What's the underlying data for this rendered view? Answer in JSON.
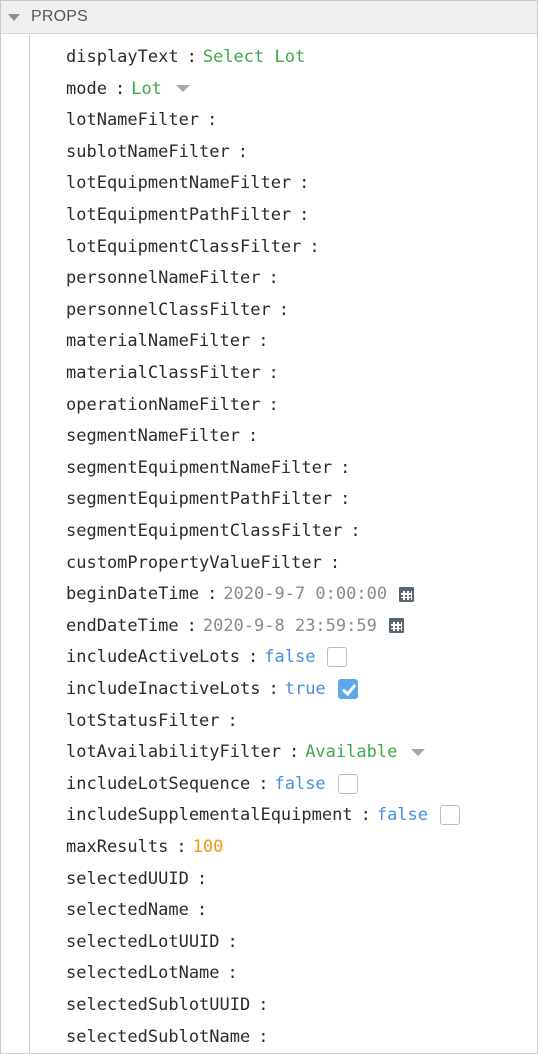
{
  "panel": {
    "title": "PROPS"
  },
  "props": [
    {
      "key": "displayText",
      "value": "Select Lot",
      "type": "string"
    },
    {
      "key": "mode",
      "value": "Lot",
      "type": "enum"
    },
    {
      "key": "lotNameFilter",
      "value": "",
      "type": "empty"
    },
    {
      "key": "sublotNameFilter",
      "value": "",
      "type": "empty"
    },
    {
      "key": "lotEquipmentNameFilter",
      "value": "",
      "type": "empty"
    },
    {
      "key": "lotEquipmentPathFilter",
      "value": "",
      "type": "empty"
    },
    {
      "key": "lotEquipmentClassFilter",
      "value": "",
      "type": "empty"
    },
    {
      "key": "personnelNameFilter",
      "value": "",
      "type": "empty"
    },
    {
      "key": "personnelClassFilter",
      "value": "",
      "type": "empty"
    },
    {
      "key": "materialNameFilter",
      "value": "",
      "type": "empty"
    },
    {
      "key": "materialClassFilter",
      "value": "",
      "type": "empty"
    },
    {
      "key": "operationNameFilter",
      "value": "",
      "type": "empty"
    },
    {
      "key": "segmentNameFilter",
      "value": "",
      "type": "empty"
    },
    {
      "key": "segmentEquipmentNameFilter",
      "value": "",
      "type": "empty"
    },
    {
      "key": "segmentEquipmentPathFilter",
      "value": "",
      "type": "empty"
    },
    {
      "key": "segmentEquipmentClassFilter",
      "value": "",
      "type": "empty"
    },
    {
      "key": "customPropertyValueFilter",
      "value": "",
      "type": "empty"
    },
    {
      "key": "beginDateTime",
      "value": "2020-9-7 0:00:00",
      "type": "date"
    },
    {
      "key": "endDateTime",
      "value": "2020-9-8 23:59:59",
      "type": "date"
    },
    {
      "key": "includeActiveLots",
      "value": "false",
      "type": "bool",
      "checked": false
    },
    {
      "key": "includeInactiveLots",
      "value": "true",
      "type": "bool",
      "checked": true
    },
    {
      "key": "lotStatusFilter",
      "value": "",
      "type": "empty"
    },
    {
      "key": "lotAvailabilityFilter",
      "value": "Available",
      "type": "enum"
    },
    {
      "key": "includeLotSequence",
      "value": "false",
      "type": "bool",
      "checked": false
    },
    {
      "key": "includeSupplementalEquipment",
      "value": "false",
      "type": "bool",
      "checked": false
    },
    {
      "key": "maxResults",
      "value": "100",
      "type": "number"
    },
    {
      "key": "selectedUUID",
      "value": "",
      "type": "empty"
    },
    {
      "key": "selectedName",
      "value": "",
      "type": "empty"
    },
    {
      "key": "selectedLotUUID",
      "value": "",
      "type": "empty"
    },
    {
      "key": "selectedLotName",
      "value": "",
      "type": "empty"
    },
    {
      "key": "selectedSublotUUID",
      "value": "",
      "type": "empty"
    },
    {
      "key": "selectedSublotName",
      "value": "",
      "type": "empty"
    }
  ],
  "colors": {
    "string": "#3fa84a",
    "bool": "#4a8fde",
    "number": "#f0950e",
    "date": "#8a8a8a",
    "checkbox_checked": "#5ba8ea"
  },
  "icons": {
    "section_toggle": "triangle-down-icon",
    "dropdown": "chevron-down-icon",
    "date_picker": "calendar-icon",
    "checkbox": "checkbox-icon"
  }
}
